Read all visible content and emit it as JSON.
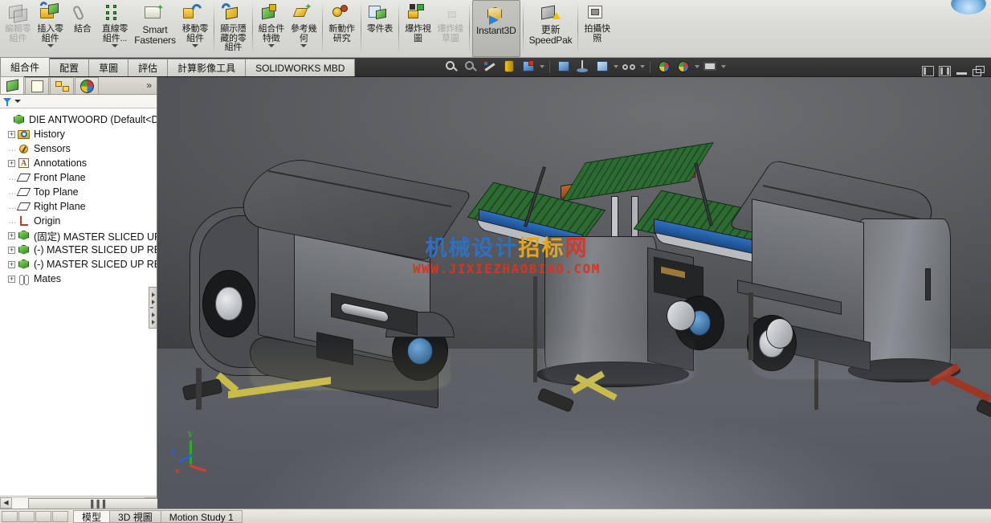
{
  "ribbon": {
    "items": [
      {
        "label": "編輯零\n組件",
        "icon": "edit-component-icon",
        "dropdown": false,
        "disabled": true
      },
      {
        "label": "插入零\n組件",
        "icon": "insert-component-icon",
        "dropdown": true,
        "disabled": false
      },
      {
        "label": "結合",
        "icon": "mate-icon",
        "dropdown": false,
        "disabled": false
      },
      {
        "label": "直線零\n組件...",
        "icon": "linear-component-pattern-icon",
        "dropdown": true,
        "disabled": false
      },
      {
        "label": "Smart\nFasteners",
        "icon": "smart-fasteners-icon",
        "dropdown": false,
        "disabled": false,
        "latin": true
      },
      {
        "label": "移動零\n組件",
        "icon": "move-component-icon",
        "dropdown": true,
        "disabled": false
      },
      {
        "label": "顯示隱\n藏的零\n組件",
        "icon": "show-hidden-components-icon",
        "dropdown": false,
        "disabled": false
      },
      {
        "label": "組合件\n特徵",
        "icon": "assembly-feature-icon",
        "dropdown": true,
        "disabled": false
      },
      {
        "label": "參考幾\n何",
        "icon": "reference-geometry-icon",
        "dropdown": true,
        "disabled": false
      },
      {
        "label": "新動作\n研究",
        "icon": "new-motion-study-icon",
        "dropdown": false,
        "disabled": false
      },
      {
        "label": "零件表",
        "icon": "bill-of-materials-icon",
        "dropdown": false,
        "disabled": false
      },
      {
        "label": "爆炸視\n圖",
        "icon": "exploded-view-icon",
        "dropdown": false,
        "disabled": false
      },
      {
        "label": "爆炸線\n草圖",
        "icon": "explode-line-sketch-icon",
        "dropdown": false,
        "disabled": true
      },
      {
        "label": "Instant3D",
        "icon": "instant3d-icon",
        "dropdown": false,
        "disabled": false,
        "latin": true,
        "selected": true
      },
      {
        "label": "更新\nSpeedPak",
        "icon": "update-speedpak-icon",
        "dropdown": false,
        "disabled": false,
        "latin": true
      },
      {
        "label": "拍攝快\n照",
        "icon": "take-snapshot-icon",
        "dropdown": false,
        "disabled": false
      }
    ]
  },
  "command_tabs": [
    {
      "label": "組合件",
      "active": true
    },
    {
      "label": "配置",
      "active": false
    },
    {
      "label": "草圖",
      "active": false
    },
    {
      "label": "評估",
      "active": false
    },
    {
      "label": "計算影像工具",
      "active": false
    },
    {
      "label": "SOLIDWORKS MBD",
      "active": false
    }
  ],
  "view_toolbar": [
    {
      "name": "zoom-to-fit-icon",
      "dropdown": false
    },
    {
      "name": "zoom-to-area-icon",
      "dropdown": false
    },
    {
      "name": "previous-view-icon",
      "dropdown": false
    },
    {
      "name": "section-view-icon",
      "dropdown": false
    },
    {
      "name": "view-orientation-icon",
      "dropdown": true
    },
    {
      "name": "display-style-icon",
      "dropdown": false
    },
    {
      "name": "hide-show-items-icon",
      "dropdown": false
    },
    {
      "name": "edit-appearance-icon",
      "dropdown": true
    },
    {
      "name": "apply-scene-icon",
      "dropdown": true
    },
    {
      "name": "view-settings-icon",
      "dropdown": true
    }
  ],
  "window_buttons": [
    {
      "name": "restore-down-left-button"
    },
    {
      "name": "restore-down-right-button"
    },
    {
      "name": "minimize-button"
    },
    {
      "name": "restore-button"
    }
  ],
  "feature_manager": {
    "tabs": [
      {
        "name": "feature-manager-design-tree-tab",
        "active": true
      },
      {
        "name": "property-manager-tab",
        "active": false
      },
      {
        "name": "configuration-manager-tab",
        "active": false
      },
      {
        "name": "display-manager-tab",
        "active": false
      }
    ],
    "more_label": "»",
    "filter_placeholder": "",
    "tree": [
      {
        "label": "DIE ANTWOORD  (Default<Dis",
        "icon": "assembly-icon",
        "expander": "none",
        "indent": 0
      },
      {
        "label": "History",
        "icon": "history-icon",
        "expander": "plus",
        "indent": 1
      },
      {
        "label": "Sensors",
        "icon": "sensors-icon",
        "expander": "dash",
        "indent": 1
      },
      {
        "label": "Annotations",
        "icon": "annotations-icon",
        "expander": "plus",
        "indent": 1
      },
      {
        "label": "Front Plane",
        "icon": "plane-icon",
        "expander": "dash",
        "indent": 1
      },
      {
        "label": "Top Plane",
        "icon": "plane-icon",
        "expander": "dash",
        "indent": 1
      },
      {
        "label": "Right Plane",
        "icon": "plane-icon",
        "expander": "dash",
        "indent": 1
      },
      {
        "label": "Origin",
        "icon": "origin-icon",
        "expander": "dash",
        "indent": 1
      },
      {
        "label": "(固定) MASTER SLICED UP R",
        "icon": "part-icon",
        "expander": "plus",
        "indent": 1
      },
      {
        "label": "(-) MASTER SLICED UP REN",
        "icon": "part-icon",
        "expander": "plus",
        "indent": 1
      },
      {
        "label": "(-) MASTER SLICED UP REN",
        "icon": "part-icon",
        "expander": "plus",
        "indent": 1
      },
      {
        "label": "Mates",
        "icon": "mates-icon",
        "expander": "plus",
        "indent": 1
      }
    ],
    "hscroll_grip": "▐▐▐"
  },
  "viewport": {
    "watermark_cn_blue": "机械设计",
    "watermark_cn_orange": "招标",
    "watermark_cn_red": "网",
    "watermark_url": "WWW.JIXIEZHAOBIAO.COM",
    "triad": {
      "x_label": "x",
      "y_label": "Y",
      "z_label": "Z",
      "x_color": "#e03a28",
      "y_color": "#2faa2f",
      "z_color": "#2f5fd0"
    },
    "background_top": "#6e7073",
    "background_bottom": "#2e3033"
  },
  "status_bar": {
    "tabs": [
      {
        "label": "模型",
        "active": true
      },
      {
        "label": "3D 視圖",
        "active": false
      },
      {
        "label": "Motion Study 1",
        "active": false
      }
    ]
  }
}
